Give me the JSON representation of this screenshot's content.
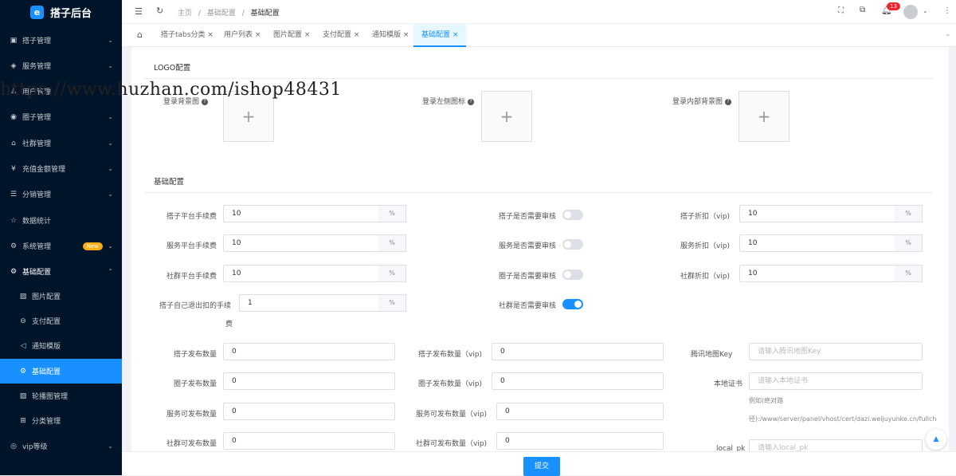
{
  "app": {
    "title": "搭子后台"
  },
  "sidebar": {
    "items": [
      {
        "label": "搭子管理",
        "icon": "grid-icon"
      },
      {
        "label": "服务管理",
        "icon": "box-icon"
      },
      {
        "label": "用户管理",
        "icon": "user-icon"
      },
      {
        "label": "圈子管理",
        "icon": "palette-icon"
      },
      {
        "label": "社群管理",
        "icon": "home-icon"
      },
      {
        "label": "充值金额管理",
        "icon": "yen-icon"
      },
      {
        "label": "分销管理",
        "icon": "list-icon"
      },
      {
        "label": "数据统计",
        "icon": "star-icon"
      },
      {
        "label": "系统管理",
        "icon": "gear-icon",
        "badge": "New"
      },
      {
        "label": "基础配置",
        "icon": "gears-icon"
      },
      {
        "label": "图片配置",
        "icon": "image-icon"
      },
      {
        "label": "支付配置",
        "icon": "minus-circle-icon"
      },
      {
        "label": "通知模版",
        "icon": "speaker-icon"
      },
      {
        "label": "基础配置",
        "icon": "gears-icon"
      },
      {
        "label": "轮播图管理",
        "icon": "image-icon"
      },
      {
        "label": "分类管理",
        "icon": "apps-icon"
      },
      {
        "label": "vip等级",
        "icon": "layers-icon"
      }
    ]
  },
  "breadcrumb": [
    "主页",
    "基础配置",
    "基础配置"
  ],
  "notifications": {
    "count": "13"
  },
  "tabs": [
    "搭子tabs分类",
    "用户列表",
    "图片配置",
    "支付配置",
    "通知模版",
    "基础配置"
  ],
  "watermark": "https://www.huzhan.com/ishop48431",
  "logo_section": {
    "title": "LOGO配置",
    "uploads": [
      "登录背景图",
      "登录左侧图标",
      "登录内部背景图"
    ]
  },
  "basic_section": {
    "title": "基础配置"
  },
  "fees": [
    {
      "label": "搭子平台手续费",
      "value": "10",
      "suffix": "%"
    },
    {
      "label": "服务平台手续费",
      "value": "10",
      "suffix": "%"
    },
    {
      "label": "社群平台手续费",
      "value": "10",
      "suffix": "%"
    },
    {
      "label": "搭子自己退出扣的手续",
      "label2": "费",
      "value": "1",
      "suffix": "%"
    }
  ],
  "reviews": [
    {
      "label": "搭子是否需要审核",
      "on": false
    },
    {
      "label": "服务是否需要审核",
      "on": false
    },
    {
      "label": "圈子是否需要审核",
      "on": false
    },
    {
      "label": "社群是否需要审核",
      "on": true
    }
  ],
  "discounts": [
    {
      "label": "搭子折扣（vip)",
      "value": "10",
      "suffix": "%"
    },
    {
      "label": "服务折扣（vip)",
      "value": "10",
      "suffix": "%"
    },
    {
      "label": "社群折扣（vip)",
      "value": "10",
      "suffix": "%"
    }
  ],
  "publish_counts": [
    {
      "label": "搭子发布数量",
      "value": "0"
    },
    {
      "label": "圈子发布数量",
      "value": "0"
    },
    {
      "label": "服务可发布数量",
      "value": "0"
    },
    {
      "label": "社群可发布数量",
      "value": "0"
    }
  ],
  "publish_counts_vip": [
    {
      "label": "搭子发布数量（vip)",
      "value": "0"
    },
    {
      "label": "圈子发布数量（vip)",
      "value": "0"
    },
    {
      "label": "服务可发布数量（vip)",
      "value": "0"
    },
    {
      "label": "社群可发布数量（vip)",
      "value": "0"
    }
  ],
  "tencent": {
    "label": "腾讯地图Key",
    "placeholder": "请输入腾讯地图Key"
  },
  "cert": {
    "label": "本地证书",
    "placeholder": "请输入本地证书",
    "hint1": "例如(绝对路",
    "hint2": "径):/www/server/panel/vhost/cert/dazi.weijuyunke.cn/fullch"
  },
  "localpk": {
    "label": "local_pk",
    "placeholder": "请输入local_pk"
  },
  "submit_label": "提交",
  "colors": {
    "accent": "#1890ff",
    "sidebar": "#001529",
    "badge": "#f5222d",
    "new_badge": "#faad14"
  }
}
